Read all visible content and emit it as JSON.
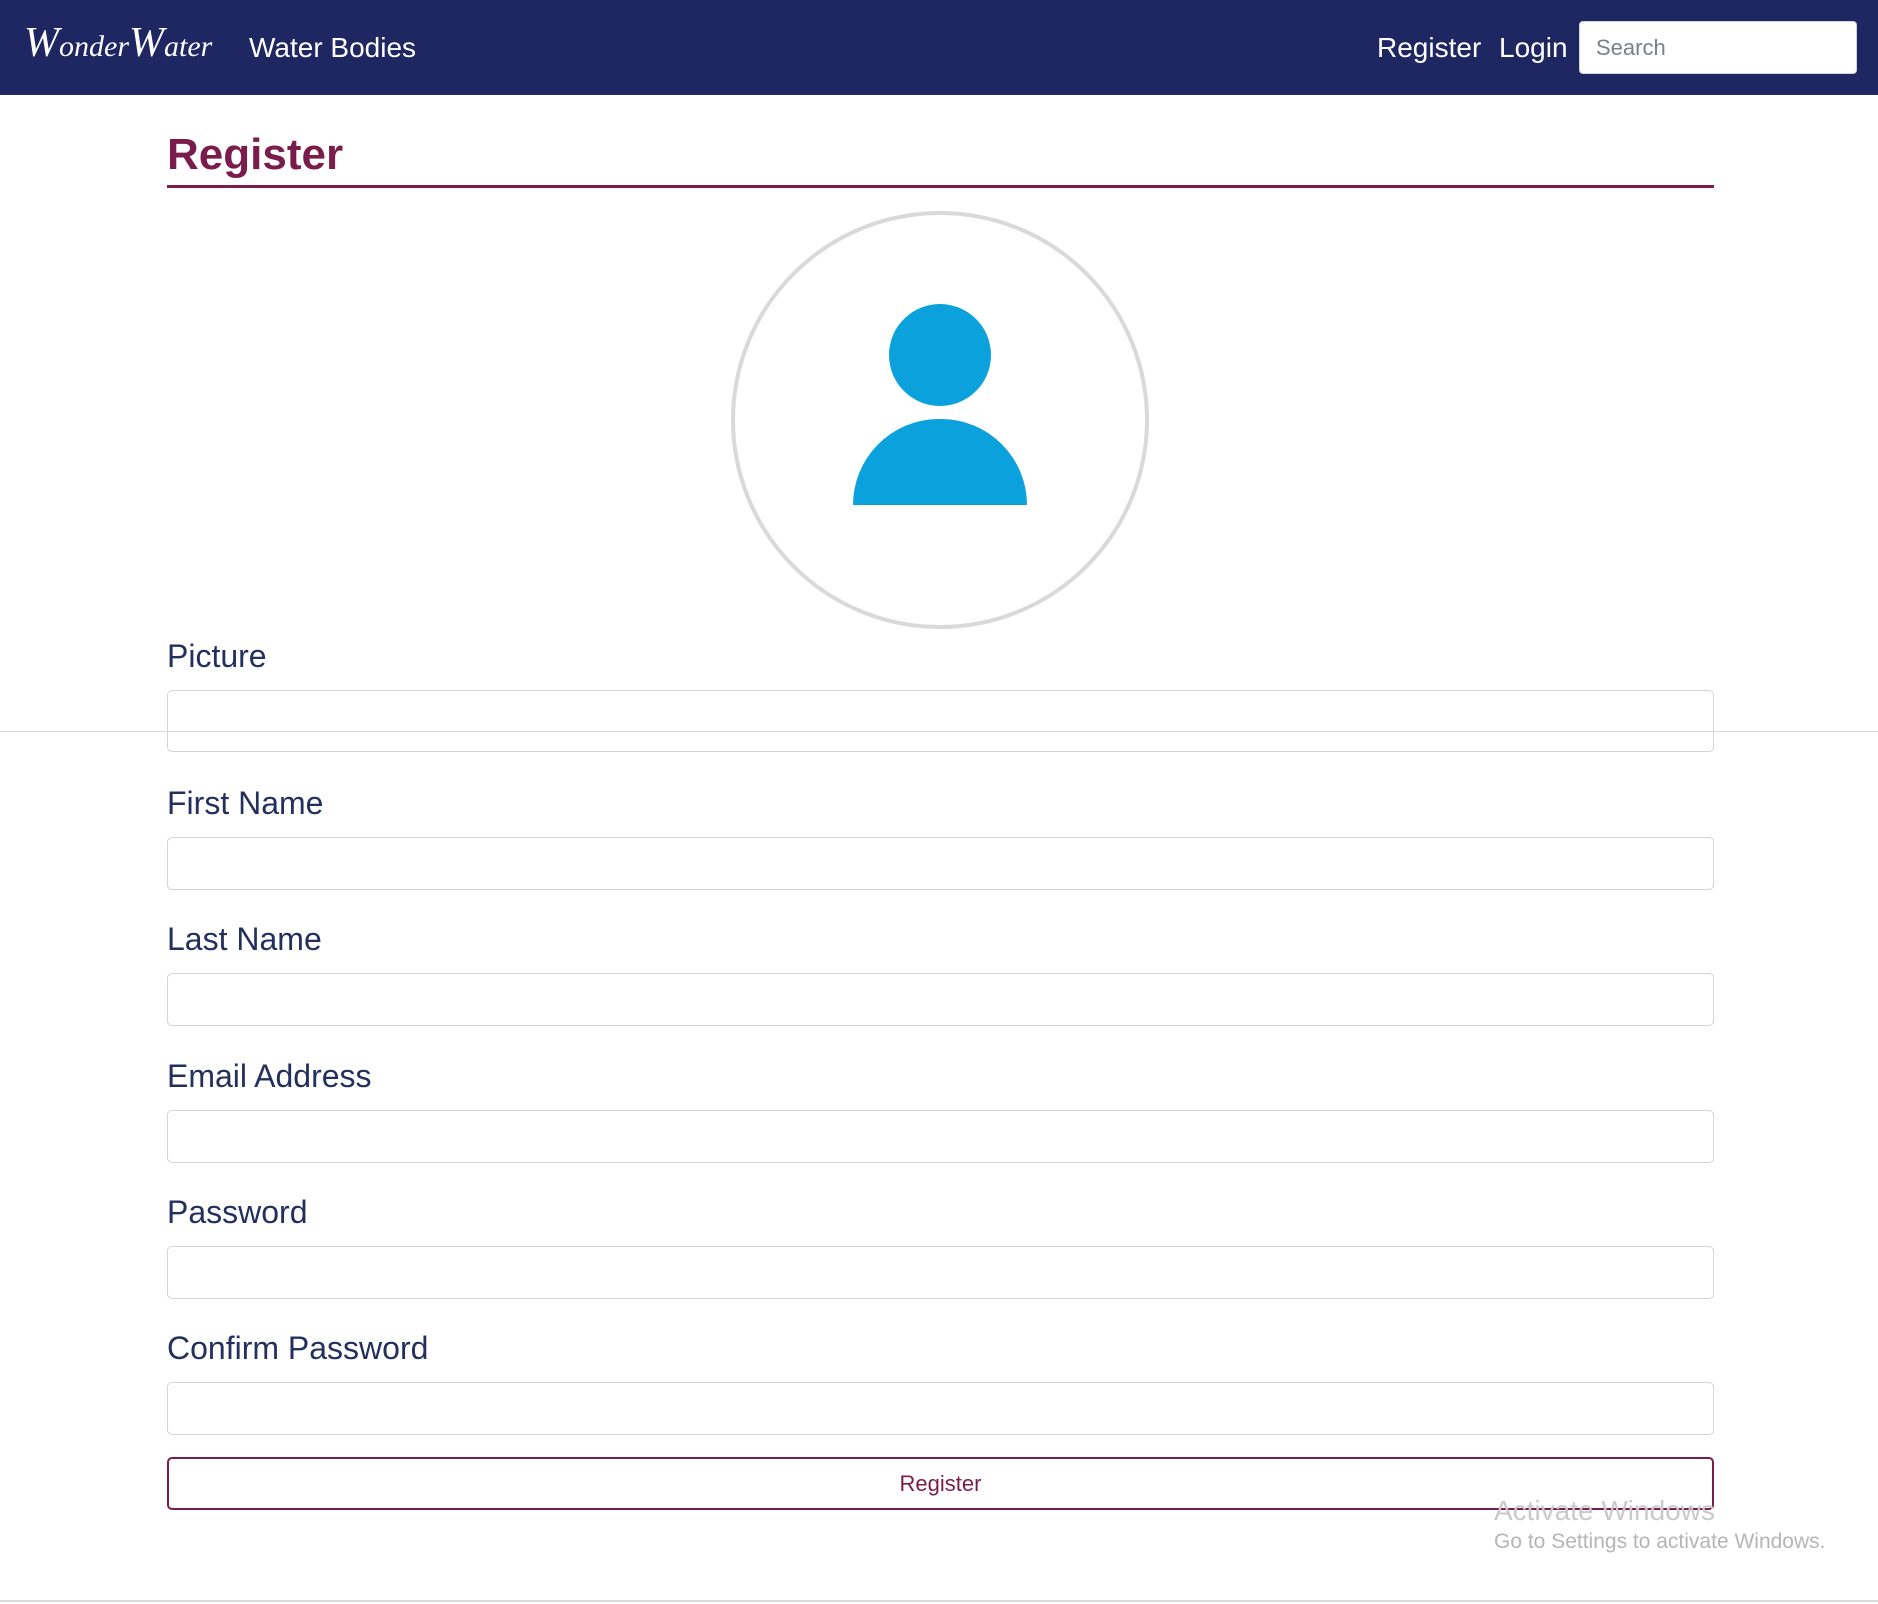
{
  "navbar": {
    "brand_w1": "W",
    "brand_rest1": "onder",
    "brand_w2": "W",
    "brand_rest2": "ater",
    "water_bodies": "Water Bodies",
    "register": "Register",
    "login": "Login",
    "search_placeholder": "Search"
  },
  "page": {
    "title": "Register"
  },
  "avatar": {
    "icon": "user-icon",
    "color": "#0ba1dd"
  },
  "form": {
    "picture_label": "Picture",
    "first_name_label": "First Name",
    "last_name_label": "Last Name",
    "email_label": "Email Address",
    "password_label": "Password",
    "confirm_password_label": "Confirm Password",
    "submit_label": "Register"
  },
  "watermark": {
    "title": "Activate Windows",
    "subtitle": "Go to Settings to activate Windows."
  },
  "colors": {
    "navbar": "#1e2761",
    "accent": "#7b1d4c",
    "text": "#23305e"
  }
}
